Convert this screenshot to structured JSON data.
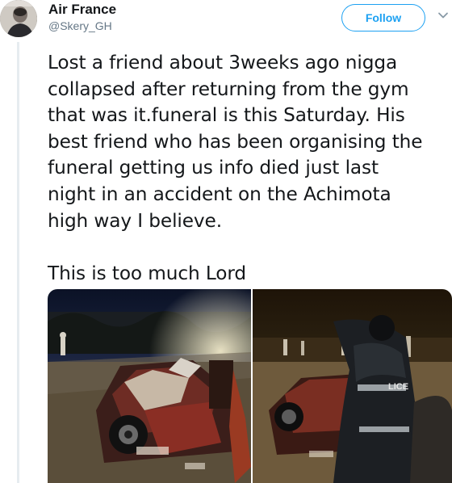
{
  "author": {
    "name": "Air France",
    "handle": "@Skery_GH"
  },
  "follow_button": {
    "label": "Follow"
  },
  "tweet": {
    "lines_para1": [
      "Lost a friend about 3weeks ago nigga",
      "collapsed after returning from the gym",
      "that was it.funeral is this Saturday. His",
      "best friend who has been organising the",
      "funeral getting us info died just last",
      "night in an accident on the Achimota",
      "high way I believe."
    ],
    "para2": "This is too much Lord"
  },
  "media": {
    "photos": [
      {
        "icon": "crashed-car-night-photo",
        "plate_text": ""
      },
      {
        "icon": "crashed-car-police-photo",
        "jacket_text": "LICE"
      }
    ]
  },
  "colors": {
    "accent": "#1da1f2",
    "text": "#14171a",
    "muted": "#657786"
  }
}
